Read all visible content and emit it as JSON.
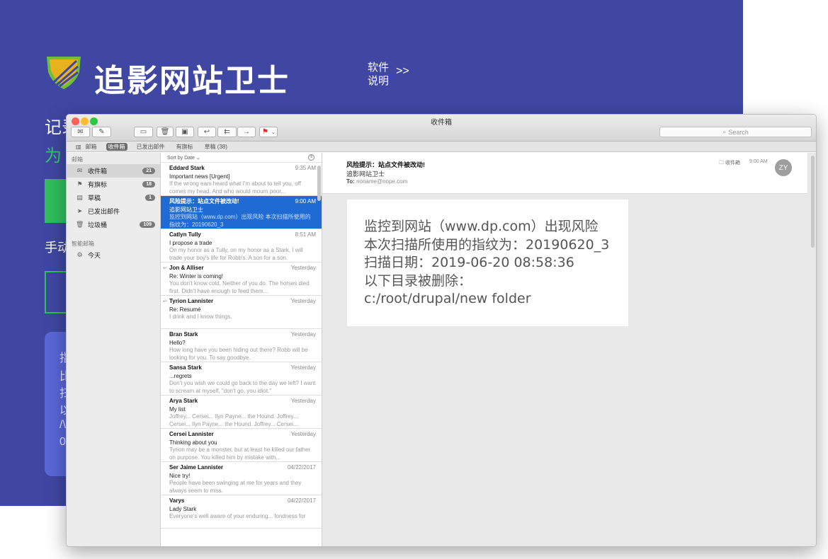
{
  "hero": {
    "title": "追影网站卫士",
    "soft_doc": "软件说明",
    "soft_doc_arrow": ">>",
    "bg_text_1": "记录",
    "bg_text_2": "为",
    "bg_text_3": "手动",
    "panel_lines": [
      "指",
      "比",
      "扫",
      "以",
      "/\\",
      "0"
    ]
  },
  "window": {
    "title": "收件箱",
    "search_placeholder": "Search",
    "favorites": [
      "邮箱",
      "收件箱",
      "已发出邮件",
      "有旗标",
      "草稿 (38)"
    ]
  },
  "sidebar": {
    "section_mailboxes": "邮箱",
    "items": [
      {
        "label": "收件箱",
        "count": "21",
        "icon": "inbox-icon",
        "glyph": "✉"
      },
      {
        "label": "有旗标",
        "count": "18",
        "icon": "flag-icon",
        "glyph": "⚑"
      },
      {
        "label": "草稿",
        "count": "1",
        "icon": "draft-icon",
        "glyph": "▤"
      },
      {
        "label": "已发出邮件",
        "count": "",
        "icon": "sent-icon",
        "glyph": "➤"
      },
      {
        "label": "垃圾桶",
        "count": "109",
        "icon": "trash-icon",
        "glyph": "🗑"
      }
    ],
    "section_smart": "智能邮箱",
    "smart_items": [
      {
        "label": "今天",
        "icon": "gear-icon",
        "glyph": "⚙"
      }
    ]
  },
  "list": {
    "sort_label": "Sort by Date ⌄",
    "messages": [
      {
        "from": "Eddard Stark",
        "time": "9:35 AM",
        "subject": "Important news [Urgent]",
        "preview": "If the wrong ears heard what I'm about to tell you, off comes my head. And who would mourn poor..."
      },
      {
        "from": "风险提示：站点文件被改动!",
        "time": "9:00 AM",
        "subject": "追影网站卫士",
        "preview": "监控到网站（www.dp.com）出现风险 本次扫描所使用的指纹为：20190620_3",
        "selected": true
      },
      {
        "from": "Catlyn Tully",
        "time": "8:51 AM",
        "subject": "I propose a trade",
        "preview": "On my honor as a Tully, on my honor as a Stark, I will trade your boy's life for Robb's. A son for a son."
      },
      {
        "from": "Jon & Alliser",
        "time": "Yesterday",
        "subject": "Re: Winter is coming!",
        "preview": "You don't know cold. Neither of you do. The horses died first. Didn't have enough to feed them...",
        "replied": true
      },
      {
        "from": "Tyrion Lannister",
        "time": "Yesterday",
        "subject": "Re: Resumé",
        "preview": "I drink and I know things.",
        "replied": true
      },
      {
        "from": "Bran Stark",
        "time": "Yesterday",
        "subject": "Hello?",
        "preview": "How long have you been hiding out there? Robb will be looking for you. To say goodbye."
      },
      {
        "from": "Sansa Stark",
        "time": "Yesterday",
        "subject": "...regrets",
        "preview": "Don't you wish we could go back to the day we left? I want to scream at myself, \"don't go, you idiot.\""
      },
      {
        "from": "Arya Stark",
        "time": "Yesterday",
        "subject": "My list",
        "preview": "Joffrey... Cersei... Ilyn Payne... the Hound. Joffrey... Cersei... Ilyn Payne... the Hound. Joffrey... Cersei..."
      },
      {
        "from": "Cersei Lannister",
        "time": "Yesterday",
        "subject": "Thinking about you",
        "preview": "Tyrion may be a monster, but at least he killed our father on purpose. You killed him by mistake with..."
      },
      {
        "from": "Ser Jaime Lannister",
        "time": "04/22/2017",
        "subject": "Nice try!",
        "preview": "People have been swinging at me for years and they always seem to miss."
      },
      {
        "from": "Varys",
        "time": "04/22/2017",
        "subject": "Lady Stark",
        "preview": "Everyone's well aware of your enduring... fondness for"
      }
    ]
  },
  "reader": {
    "subject": "风险提示：站点文件被改动!",
    "from": "追影网站卫士",
    "to_label": "To:",
    "to": "noname@nope.com",
    "folder": "收件箱",
    "time": "9:00 AM",
    "avatar": "ZY",
    "body_lines": [
      "监控到网站（www.dp.com）出现风险",
      "本次扫描所使用的指纹为：20190620_3",
      "扫描日期：2019-06-20 08:58:36",
      "以下目录被删除：",
      "c:/root/drupal/new folder"
    ]
  }
}
